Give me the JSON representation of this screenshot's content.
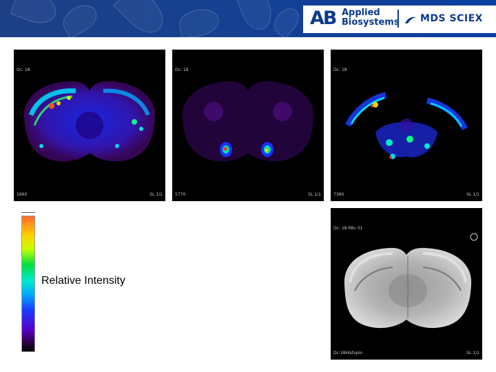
{
  "header": {
    "logo_ab": "AB",
    "logo_line1": "Applied",
    "logo_line2": "Biosystems",
    "logo_mds": "MDS SCIEX"
  },
  "panels": [
    {
      "id": "image-1",
      "top_left": "Oc: 18",
      "bottom_left": "1660",
      "bottom_right": "SL 1/1"
    },
    {
      "id": "image-2",
      "top_left": "Oc: 18",
      "bottom_left": "5770",
      "bottom_right": "SL 1/1"
    },
    {
      "id": "image-3",
      "top_left": "Oc: 18",
      "bottom_left": "7380",
      "bottom_right": "SL 1/1"
    },
    {
      "id": "image-4",
      "top_left": "Oc: 18 RBc 01",
      "bottom_left": "Dc:18Histopio",
      "bottom_right": "SL 1/1"
    }
  ],
  "colorbar": {
    "label": "Relative Intensity"
  },
  "colors": {
    "banner": "#16418f",
    "logo_blue": "#0b3a8f",
    "panel_bg": "#000000"
  }
}
